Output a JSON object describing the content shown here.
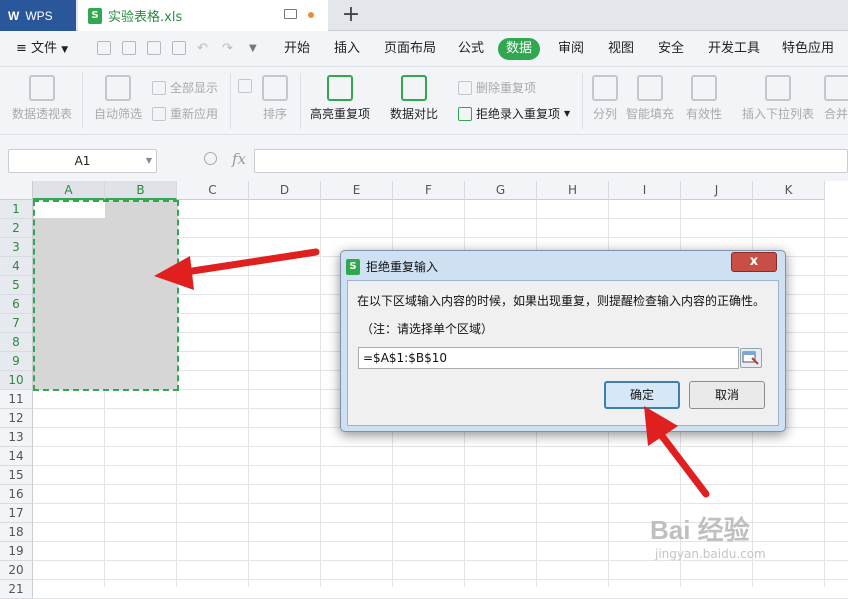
{
  "app": {
    "brand": "WPS",
    "file_tab": "实验表格.xls"
  },
  "menu": {
    "file": "文件",
    "items": [
      "开始",
      "插入",
      "页面布局",
      "公式",
      "数据",
      "审阅",
      "视图",
      "安全",
      "开发工具",
      "特色应用"
    ],
    "active": "数据"
  },
  "ribbon": {
    "pivot": "数据透视表",
    "autofilter": "自动筛选",
    "show_all": "全部显示",
    "reapply": "重新应用",
    "sort": "排序",
    "highlight_dup": "高亮重复项",
    "compare": "数据对比",
    "remove_dup": "删除重复项",
    "reject_dup": "拒绝录入重复项",
    "split": "分列",
    "smart_fill": "智能填充",
    "validity": "有效性",
    "insert_dropdown": "插入下拉列表",
    "merge": "合并"
  },
  "formula_bar": {
    "name_box": "A1",
    "fx": "fx",
    "formula": ""
  },
  "grid": {
    "columns": [
      "A",
      "B",
      "C",
      "D",
      "E",
      "F",
      "G",
      "H",
      "I",
      "J",
      "K"
    ],
    "rows": [
      "1",
      "2",
      "3",
      "4",
      "5",
      "6",
      "7",
      "8",
      "9",
      "10",
      "11",
      "12",
      "13",
      "14",
      "15",
      "16",
      "17",
      "18",
      "19",
      "20",
      "21"
    ],
    "selection": "A1:B10"
  },
  "dialog": {
    "title": "拒绝重复输入",
    "message": "在以下区域输入内容的时候，如果出现重复，则提醒检查输入内容的正确性。",
    "note": "（注：请选择单个区域）",
    "range_value": "=$A$1:$B$10",
    "ok": "确定",
    "cancel": "取消",
    "close": "x"
  },
  "watermark": {
    "text": "Bai 经验",
    "url": "jingyan.baidu.com"
  },
  "colors": {
    "accent": "#2fa84f",
    "brand_bar": "#2a579a",
    "arrow": "#e01f1f"
  }
}
